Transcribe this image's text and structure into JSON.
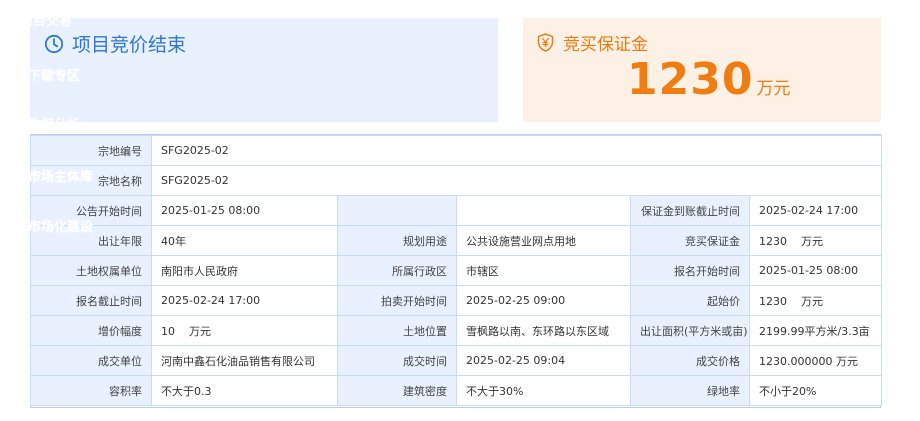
{
  "sidebar": {
    "items": [
      "项目交易",
      "下载专区",
      "数据分析",
      "市场主体库",
      "市场化建设"
    ]
  },
  "status_panel": {
    "label": "项目竞价结束",
    "icon": "clock-icon",
    "color": "#2f76d8"
  },
  "deposit_panel": {
    "label": "竞买保证金",
    "icon": "shield-yen-icon",
    "amount": "1230",
    "unit": "万元",
    "color": "#f07d12"
  },
  "details": {
    "parcel_no": {
      "label": "宗地编号",
      "value": "SFG2025-02"
    },
    "parcel_name": {
      "label": "宗地名称",
      "value": "SFG2025-02"
    },
    "announce_start": {
      "label": "公告开始时间",
      "value": "2025-01-25 08:00"
    },
    "deposit_deadline": {
      "label": "保证金到账截止时间",
      "value": "2025-02-24 17:00"
    },
    "term": {
      "label": "出让年限",
      "value": "40年"
    },
    "planned_use": {
      "label": "规划用途",
      "value": "公共设施营业网点用地"
    },
    "bid_deposit": {
      "label": "竞买保证金",
      "value": "1230    万元"
    },
    "owner": {
      "label": "土地权属单位",
      "value": "南阳市人民政府"
    },
    "district": {
      "label": "所属行政区",
      "value": "市辖区"
    },
    "reg_start": {
      "label": "报名开始时间",
      "value": "2025-01-25 08:00"
    },
    "reg_end": {
      "label": "报名截止时间",
      "value": "2025-02-24 17:00"
    },
    "auction_start": {
      "label": "拍卖开始时间",
      "value": "2025-02-25 09:00"
    },
    "start_price": {
      "label": "起始价",
      "value": "1230    万元"
    },
    "increment": {
      "label": "增价幅度",
      "value": "10    万元"
    },
    "location": {
      "label": "土地位置",
      "value": "雪枫路以南、东环路以东区域"
    },
    "area": {
      "label": "出让面积(平方米或亩)",
      "value": "2199.99平方米/3.3亩"
    },
    "buyer": {
      "label": "成交单位",
      "value": "河南中鑫石化油品销售有限公司"
    },
    "deal_time": {
      "label": "成交时间",
      "value": "2025-02-25 09:04"
    },
    "deal_price": {
      "label": "成交价格",
      "value": "1230.000000 万元"
    },
    "far": {
      "label": "容积率",
      "value": "不大于0.3"
    },
    "density": {
      "label": "建筑密度",
      "value": "不大于30%"
    },
    "green_ratio": {
      "label": "绿地率",
      "value": "不小于20%"
    }
  }
}
